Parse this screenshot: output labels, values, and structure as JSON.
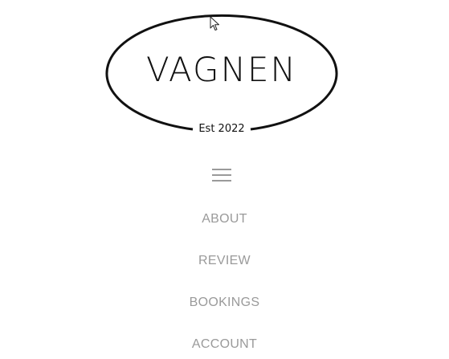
{
  "logo": {
    "name": "VAGNEN",
    "established": "Est 2022"
  },
  "menu": {
    "toggle_icon": "hamburger-menu-icon"
  },
  "nav": {
    "items": [
      {
        "label": "ABOUT"
      },
      {
        "label": "REVIEW"
      },
      {
        "label": "BOOKINGS"
      },
      {
        "label": "ACCOUNT"
      }
    ]
  },
  "colors": {
    "text_dark": "#111111",
    "nav_gray": "#9a9a9a",
    "background": "#ffffff"
  }
}
